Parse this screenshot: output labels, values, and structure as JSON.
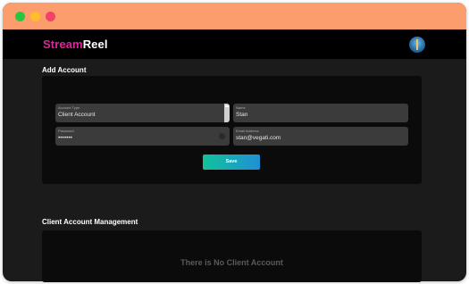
{
  "window": {
    "controls": [
      "close",
      "minimize",
      "maximize"
    ]
  },
  "header": {
    "logo_part1": "Stream",
    "logo_part2": "Reel",
    "avatar_icon": "user-avatar-icon"
  },
  "add_account": {
    "title": "Add Account",
    "fields": {
      "account_type": {
        "label": "Account Type",
        "value": "Client Account"
      },
      "name": {
        "label": "Name",
        "value": "Stan"
      },
      "password": {
        "label": "Password",
        "value": "•••••••"
      },
      "email": {
        "label": "Email Address",
        "value": "stan@vegati.com"
      }
    },
    "save_label": "Save"
  },
  "client_management": {
    "title": "Client Account Management",
    "empty_message": "There is No Client Account"
  },
  "colors": {
    "titlebar": "#fb9d6c",
    "logo_accent": "#e0249b",
    "button_gradient_start": "#12c29a",
    "button_gradient_end": "#1f8fd6"
  }
}
